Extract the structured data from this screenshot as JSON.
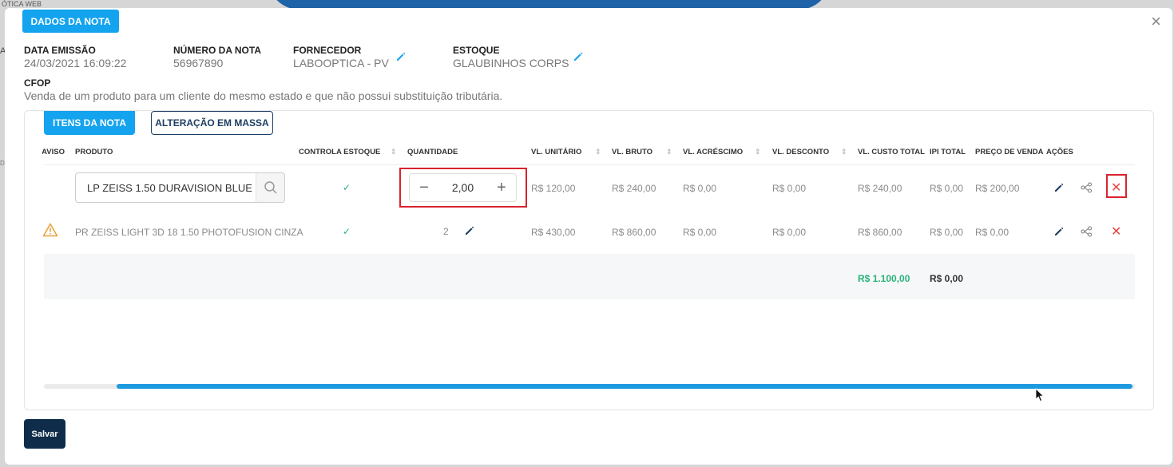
{
  "background": {
    "label": "ÓTICA WEB",
    "edge_a": "A",
    "edge_b": "DI"
  },
  "modal": {
    "close": "×",
    "dados_label": "DADOS DA NOTA",
    "fields": {
      "data_emissao_label": "DATA EMISSÃO",
      "data_emissao_value": "24/03/2021 16:09:22",
      "numero_label": "NÚMERO DA NOTA",
      "numero_value": "56967890",
      "fornecedor_label": "FORNECEDOR",
      "fornecedor_value": "LABOOPTICA - PV",
      "estoque_label": "ESTOQUE",
      "estoque_value": "GLAUBINHOS CORPS",
      "cfop_label": "CFOP",
      "cfop_value": "Venda de um produto para um cliente do mesmo estado e que não possui substituição tributária."
    },
    "tabs": {
      "itens": "ITENS DA NOTA",
      "alteracao": "ALTERAÇÃO EM MASSA"
    },
    "columns": {
      "aviso": "AVISO",
      "produto": "PRODUTO",
      "controla": "CONTROLA ESTOQUE",
      "quantidade": "QUANTIDADE",
      "vl_unitario": "VL. UNITÁRIO",
      "vl_bruto": "VL. BRUTO",
      "vl_acrescimo": "VL. ACRÉSCIMO",
      "vl_desconto": "VL. DESCONTO",
      "vl_custo_total": "VL. CUSTO TOTAL",
      "ipi_total": "IPI TOTAL",
      "preco_venda": "PREÇO DE VENDA",
      "acoes": "AÇÕES"
    },
    "rows": [
      {
        "produto": "LP ZEISS 1.50 DURAVISION BLUE",
        "controla": "✓",
        "quantidade": "2,00",
        "vl_unitario": "R$ 120,00",
        "vl_bruto": "R$ 240,00",
        "vl_acrescimo": "R$ 0,00",
        "vl_desconto": "R$ 0,00",
        "vl_custo_total": "R$ 240,00",
        "ipi_total": "R$ 0,00",
        "preco_venda": "R$ 200,00"
      },
      {
        "produto": "PR ZEISS LIGHT 3D 18 1.50 PHOTOFUSION CINZA",
        "controla": "✓",
        "quantidade": "2",
        "vl_unitario": "R$ 430,00",
        "vl_bruto": "R$ 860,00",
        "vl_acrescimo": "R$ 0,00",
        "vl_desconto": "R$ 0,00",
        "vl_custo_total": "R$ 860,00",
        "ipi_total": "R$ 0,00",
        "preco_venda": "R$ 0,00"
      }
    ],
    "totals": {
      "custo_total": "R$ 1.100,00",
      "ipi_total": "R$ 0,00"
    },
    "save_label": "Salvar",
    "icons": {
      "minus": "−",
      "plus": "+",
      "delete": "✕",
      "sort": "⇕"
    },
    "colors": {
      "primary": "#13a3ef",
      "dark": "#0f2d4b",
      "danger": "#e5473f",
      "success": "#2ab37a",
      "total_green": "#2ab37a"
    }
  }
}
